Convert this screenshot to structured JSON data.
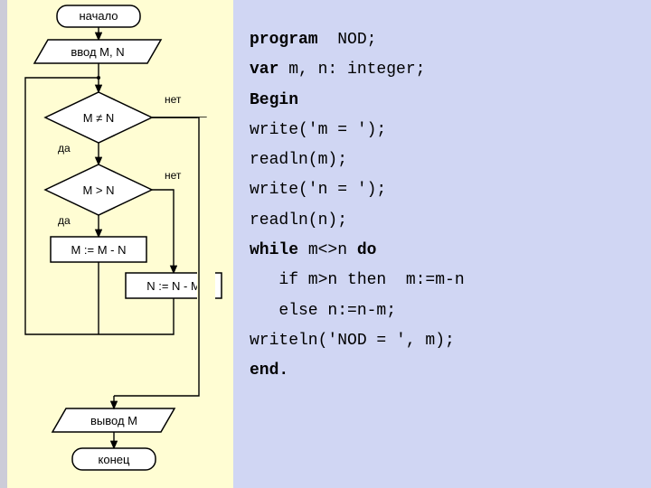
{
  "flowchart": {
    "start": "начало",
    "input": "ввод  M, N",
    "cond1": "M ≠ N",
    "cond2": "M > N",
    "assign1": "M := M - N",
    "assign2": "N := N - M",
    "output": "вывод  M",
    "end": "конец",
    "yes": "да",
    "no": "нет"
  },
  "code": {
    "l1a": "program",
    "l1b": "  NOD;",
    "l2a": "var",
    "l2b": " m, n: integer;",
    "l3": "Begin",
    "l4": "write('m = ');",
    "l5": "readln(m);",
    "l6": "write('n = ');",
    "l7": "readln(n);",
    "l8a": "while",
    "l8b": " m<>n ",
    "l8c": "do",
    "l9": "   if m>n then  m:=m-n",
    "l10": "   else n:=n-m;",
    "l11": "writeln('NOD = ', m);",
    "l12": "end."
  }
}
